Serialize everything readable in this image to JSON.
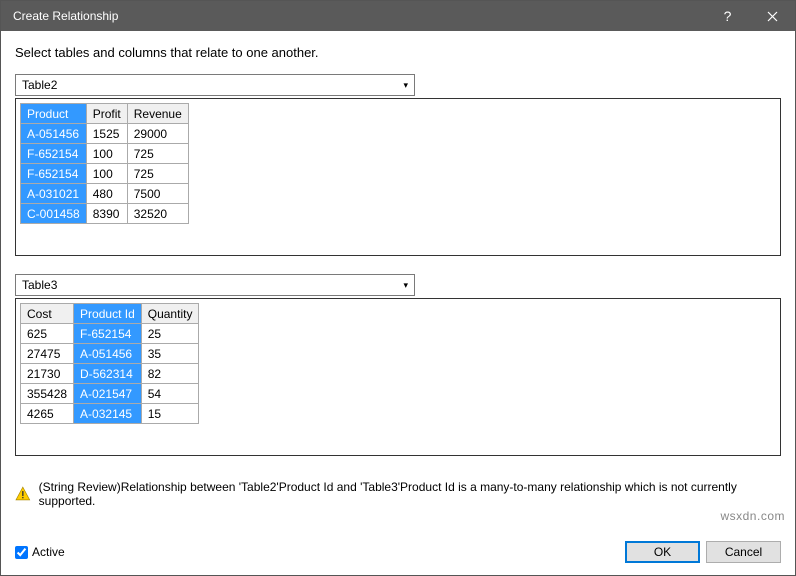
{
  "window": {
    "title": "Create Relationship"
  },
  "instruction": "Select tables and columns that relate to one another.",
  "top": {
    "dropdown": "Table2",
    "headers": [
      "Product",
      "Profit",
      "Revenue"
    ],
    "selected_col": 0,
    "rows": [
      [
        "A-051456",
        "1525",
        "29000"
      ],
      [
        "F-652154",
        "100",
        "725"
      ],
      [
        "F-652154",
        "100",
        "725"
      ],
      [
        "A-031021",
        "480",
        "7500"
      ],
      [
        "C-001458",
        "8390",
        "32520"
      ]
    ]
  },
  "bottom": {
    "dropdown": "Table3",
    "headers": [
      "Cost",
      "Product Id",
      "Quantity"
    ],
    "selected_col": 1,
    "rows": [
      [
        "625",
        "F-652154",
        "25"
      ],
      [
        "27475",
        "A-051456",
        "35"
      ],
      [
        "21730",
        "D-562314",
        "82"
      ],
      [
        "355428",
        "A-021547",
        "54"
      ],
      [
        "4265",
        "A-032145",
        "15"
      ]
    ]
  },
  "warning": "(String Review)Relationship between 'Table2'Product Id and 'Table3'Product Id is a many-to-many relationship which is not currently supported.",
  "footer": {
    "active_label": "Active",
    "active_checked": true,
    "ok": "OK",
    "cancel": "Cancel"
  },
  "watermark": "wsxdn.com"
}
